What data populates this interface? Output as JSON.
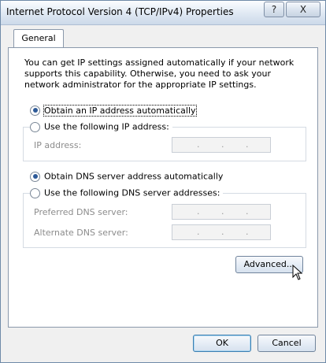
{
  "window": {
    "title": "Internet Protocol Version 4 (TCP/IPv4) Properties",
    "help_label": "?",
    "close_label": "X"
  },
  "tabs": [
    {
      "label": "General"
    }
  ],
  "general": {
    "description": "You can get IP settings assigned automatically if your network supports this capability. Otherwise, you need to ask your network administrator for the appropriate IP settings.",
    "ip_options": {
      "auto_label": "Obtain an IP address automatically",
      "manual_label": "Use the following IP address:",
      "selected": "auto"
    },
    "ip_fields": [
      {
        "label": "IP address:",
        "value": ". . ."
      }
    ],
    "dns_options": {
      "auto_label": "Obtain DNS server address automatically",
      "manual_label": "Use the following DNS server addresses:",
      "selected": "auto"
    },
    "dns_fields": [
      {
        "label": "Preferred DNS server:",
        "value": ". . ."
      },
      {
        "label": "Alternate DNS server:",
        "value": ". . ."
      }
    ],
    "advanced_label": "Advanced..."
  },
  "footer": {
    "ok_label": "OK",
    "cancel_label": "Cancel"
  }
}
